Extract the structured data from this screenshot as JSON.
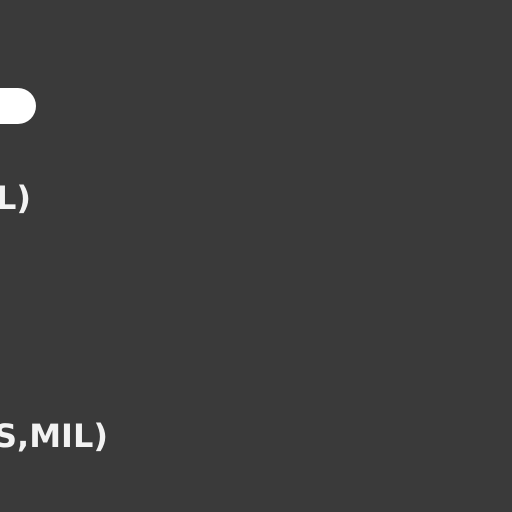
{
  "colors": {
    "background": "#3a3a3a",
    "text": "#f2f2f2",
    "pill": "#ffffff"
  },
  "labels": {
    "top": "L)",
    "bottom": "S,MIL)"
  }
}
